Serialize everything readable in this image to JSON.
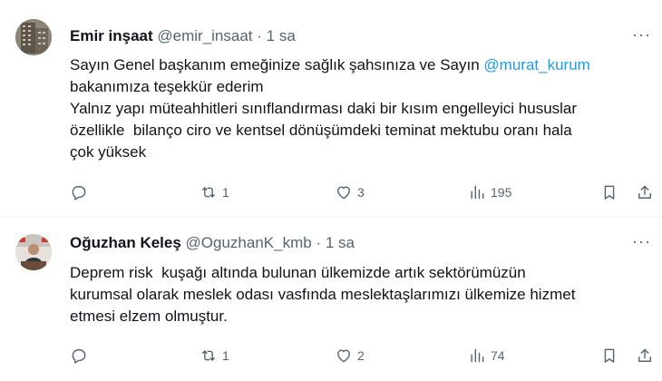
{
  "tweets": [
    {
      "name": "Emir inşaat",
      "handle": "@emir_insaat",
      "dot": "·",
      "time": "1 sa",
      "more": "···",
      "body": {
        "l1a": "Sayın Genel başkanım emeğinize sağlık şahsınıza ve Sayın ",
        "mention": "@murat_kurum",
        "l2": "bakanımıza teşekkür ederim",
        "l3": "Yalnız yapı müteahhitleri sınıflandırması daki bir kısım engelleyici hususlar",
        "l4": "özellikle  bilanço ciro ve kentsel dönüşümdeki teminat mektubu oranı hala",
        "l5": "çok yüksek"
      },
      "actions": {
        "replies": "",
        "retweets": "1",
        "likes": "3",
        "views": "195"
      },
      "icons": [
        "reply-icon",
        "retweet-icon",
        "like-icon",
        "views-icon",
        "bookmark-icon",
        "share-icon"
      ]
    },
    {
      "name": "Oğuzhan Keleş",
      "handle": "@OguzhanK_kmb",
      "dot": "·",
      "time": "1 sa",
      "more": "···",
      "body": {
        "l1": "Deprem risk  kuşağı altında bulunan ülkemizde artık sektörümüzün",
        "l2": "kurumsal olarak meslek odası vasfında meslektaşlarımızı ülkemize hizmet",
        "l3": "etmesi elzem olmuştur."
      },
      "actions": {
        "replies": "",
        "retweets": "1",
        "likes": "2",
        "views": "74"
      },
      "icons": [
        "reply-icon",
        "retweet-icon",
        "like-icon",
        "views-icon",
        "bookmark-icon",
        "share-icon"
      ]
    }
  ],
  "colors": {
    "text": "#0f1419",
    "secondary": "#536471",
    "link": "#1d9bf0",
    "divider": "#eff3f4"
  }
}
